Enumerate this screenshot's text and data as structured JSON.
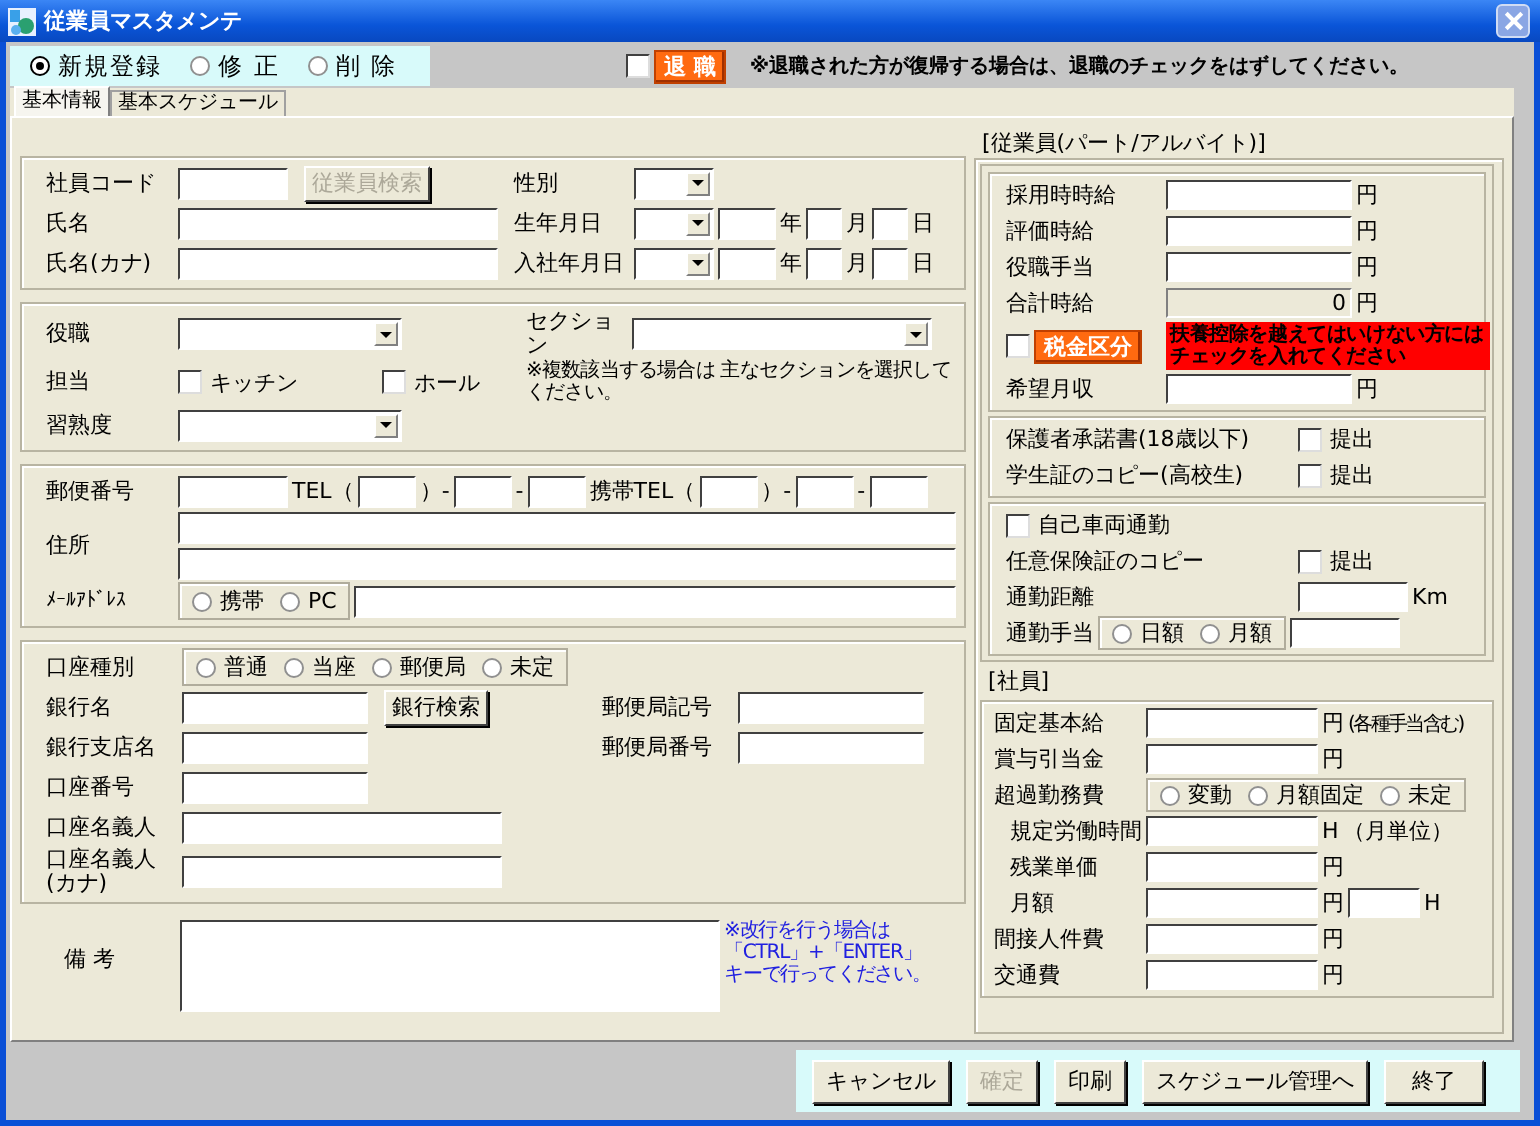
{
  "window": {
    "title": "従業員マスタメンテ"
  },
  "mode_options": [
    {
      "label": "新規登録",
      "selected": true
    },
    {
      "label": "修 正",
      "selected": false
    },
    {
      "label": "削 除",
      "selected": false
    }
  ],
  "retired": {
    "checked": false,
    "label": "退 職",
    "note": "※退職された方が復帰する場合は、退職のチェックをはずしてください。"
  },
  "tabs": [
    {
      "label": "基本情報",
      "selected": true
    },
    {
      "label": "基本スケジュール",
      "selected": false
    }
  ],
  "left_sections": [
    {
      "rows": [
        [
          [
            {
              "kind": "label",
              "text": "社員コード"
            }
          ],
          [
            {
              "kind": "short_field"
            },
            {
              "kind": "button",
              "label": "従業員検索",
              "disabled": true
            }
          ],
          [
            {
              "kind": "label",
              "text": "性別"
            }
          ],
          [
            {
              "kind": "small_select"
            }
          ]
        ],
        [
          [
            {
              "kind": "label",
              "text": "氏名"
            }
          ],
          [
            {
              "kind": "long_field"
            }
          ],
          [
            {
              "kind": "label",
              "text": "生年月日"
            }
          ],
          [
            {
              "kind": "small_select"
            },
            {
              "kind": "small_field"
            },
            {
              "kind": "unit",
              "text": "年"
            },
            {
              "kind": "tiny_field"
            },
            {
              "kind": "unit",
              "text": "月"
            },
            {
              "kind": "tiny_field"
            },
            {
              "kind": "unit",
              "text": "日"
            }
          ]
        ],
        [
          [
            {
              "kind": "label",
              "text": "氏名(カナ)"
            }
          ],
          [
            {
              "kind": "long_field"
            }
          ],
          [
            {
              "kind": "label",
              "text": "入社年月日"
            }
          ],
          [
            {
              "kind": "small_select"
            },
            {
              "kind": "small_field"
            },
            {
              "kind": "unit",
              "text": "年"
            },
            {
              "kind": "tiny_field"
            },
            {
              "kind": "unit",
              "text": "月"
            },
            {
              "kind": "tiny_field"
            },
            {
              "kind": "unit",
              "text": "日"
            }
          ]
        ]
      ]
    },
    {
      "rows": [
        [
          [
            {
              "kind": "label",
              "text": "役職"
            }
          ],
          [
            {
              "kind": "select"
            }
          ],
          [
            {
              "kind": "label",
              "text": "セクション"
            }
          ],
          [
            {
              "kind": "wide_select"
            }
          ]
        ],
        [
          [
            {
              "kind": "label",
              "text": "担当"
            }
          ],
          [
            {
              "kind": "check",
              "label": "キッチン",
              "checked": false
            },
            {
              "kind": "check",
              "label": "ホール",
              "checked": false
            }
          ],
          [
            {
              "kind": "note",
              "text": "※複数該当する場合は 主なセクションを選択してください。"
            }
          ]
        ],
        [
          [
            {
              "kind": "label",
              "text": "習熟度"
            }
          ],
          [
            {
              "kind": "select"
            }
          ]
        ]
      ]
    },
    {
      "rows": [
        [
          [
            {
              "kind": "label",
              "text": "郵便番号"
            }
          ],
          [
            {
              "kind": "short_field"
            },
            {
              "kind": "unit",
              "text": "TEL（"
            },
            {
              "kind": "small_field"
            },
            {
              "kind": "unit",
              "text": "）-"
            },
            {
              "kind": "small_field"
            },
            {
              "kind": "unit",
              "text": "-"
            },
            {
              "kind": "small_field"
            },
            {
              "kind": "unit",
              "text": "携帯TEL（"
            },
            {
              "kind": "small_field"
            },
            {
              "kind": "unit",
              "text": "）-"
            },
            {
              "kind": "small_field"
            },
            {
              "kind": "unit",
              "text": "-"
            },
            {
              "kind": "small_field"
            }
          ]
        ],
        [
          [
            {
              "kind": "label",
              "text": "住所"
            }
          ],
          [
            {
              "kind": "line_field"
            },
            {
              "kind": "line_field"
            }
          ]
        ],
        [
          [
            {
              "kind": "small_label",
              "text": "ﾒｰﾙｱﾄﾞﾚｽ"
            }
          ],
          [
            {
              "kind": "radio_group",
              "options": [
                {
                  "label": "携帯",
                  "selected": false
                },
                {
                  "label": "PC",
                  "selected": false
                }
              ]
            },
            {
              "kind": "wide_field"
            }
          ]
        ]
      ]
    },
    {
      "rows": [
        [
          [
            {
              "kind": "label",
              "text": "口座種別"
            }
          ],
          [
            {
              "kind": "radio_group",
              "options": [
                {
                  "label": "普通",
                  "selected": false
                },
                {
                  "label": "当座",
                  "selected": false
                },
                {
                  "label": "郵便局",
                  "selected": false
                },
                {
                  "label": "未定",
                  "selected": false
                }
              ]
            }
          ]
        ],
        [
          [
            {
              "kind": "label",
              "text": "銀行名"
            }
          ],
          [
            {
              "kind": "medium_field"
            },
            {
              "kind": "button",
              "label": "銀行検索",
              "disabled": false
            }
          ],
          [
            {
              "kind": "label",
              "text": "郵便局記号"
            }
          ],
          [
            {
              "kind": "medium_field"
            }
          ]
        ],
        [
          [
            {
              "kind": "label",
              "text": "銀行支店名"
            }
          ],
          [
            {
              "kind": "medium_field"
            }
          ],
          [
            {
              "kind": "label",
              "text": "郵便局番号"
            }
          ],
          [
            {
              "kind": "medium_field"
            }
          ]
        ],
        [
          [
            {
              "kind": "label",
              "text": "口座番号"
            }
          ],
          [
            {
              "kind": "medium_field"
            }
          ]
        ],
        [
          [
            {
              "kind": "label",
              "text": "口座名義人"
            }
          ],
          [
            {
              "kind": "long_field"
            }
          ]
        ],
        [
          [
            {
              "kind": "label",
              "text": "口座名義人(カナ)"
            }
          ],
          [
            {
              "kind": "long_field"
            }
          ]
        ]
      ]
    }
  ],
  "remarks": {
    "rows": [
      [
        [
          {
            "kind": "label",
            "text": "備 考"
          }
        ],
        [
          {
            "kind": "memo_field"
          },
          {
            "kind": "help",
            "text": "※改行を行う場合は「CTRL」+「ENTER」キーで行ってください。"
          }
        ]
      ]
    ]
  },
  "part_time": {
    "heading": "[従業員(パート/アルバイト)]",
    "groups": [
      {
        "rows": [
          [
            [
              {
                "kind": "label",
                "text": "採用時時給"
              }
            ],
            [
              {
                "kind": "medium_field"
              },
              {
                "kind": "unit",
                "text": "円"
              }
            ]
          ],
          [
            [
              {
                "kind": "label",
                "text": "評価時給"
              }
            ],
            [
              {
                "kind": "medium_field"
              },
              {
                "kind": "unit",
                "text": "円"
              }
            ]
          ],
          [
            [
              {
                "kind": "label",
                "text": "役職手当"
              }
            ],
            [
              {
                "kind": "medium_field"
              },
              {
                "kind": "unit",
                "text": "円"
              }
            ]
          ],
          [
            [
              {
                "kind": "label",
                "text": "合計時給"
              }
            ],
            [
              {
                "kind": "readonly_field",
                "value": "0"
              },
              {
                "kind": "unit",
                "text": "円"
              }
            ]
          ],
          [
            [
              {
                "kind": "check",
                "checked": false
              },
              {
                "kind": "flag_button",
                "label": "税金区分"
              }
            ],
            [
              {
                "kind": "alert",
                "text": "扶養控除を越えてはいけない方にはチェックを入れてください"
              }
            ]
          ],
          [
            [
              {
                "kind": "label",
                "text": "希望月収"
              }
            ],
            [
              {
                "kind": "medium_field"
              },
              {
                "kind": "unit",
                "text": "円"
              }
            ]
          ]
        ]
      },
      {
        "rows": [
          [
            [
              {
                "kind": "label",
                "text": "保護者承諾書(18歳以下)"
              }
            ],
            [
              {
                "kind": "check",
                "label": "提出",
                "checked": false
              }
            ]
          ],
          [
            [
              {
                "kind": "label",
                "text": "学生証のコピー(高校生)"
              }
            ],
            [
              {
                "kind": "check",
                "label": "提出",
                "checked": false
              }
            ]
          ]
        ]
      },
      {
        "rows": [
          [
            [
              {
                "kind": "check",
                "label": "自己車両通勤",
                "checked": false
              }
            ]
          ],
          [
            [
              {
                "kind": "label",
                "text": "任意保険証のコピー"
              }
            ],
            [
              {
                "kind": "check",
                "label": "提出",
                "checked": false
              }
            ]
          ],
          [
            [
              {
                "kind": "label",
                "text": "通勤距離"
              }
            ],
            [
              {
                "kind": "short_field"
              },
              {
                "kind": "unit",
                "text": "Km"
              }
            ]
          ],
          [
            [
              {
                "kind": "label",
                "text": "通勤手当"
              },
              {
                "kind": "radio_group",
                "options": [
                  {
                    "label": "日額",
                    "selected": false
                  },
                  {
                    "label": "月額",
                    "selected": false
                  }
                ]
              },
              {
                "kind": "short_field"
              }
            ]
          ]
        ]
      }
    ]
  },
  "staff": {
    "heading": "[社員]",
    "rows": [
      [
        [
          {
            "kind": "label",
            "text": "固定基本給"
          }
        ],
        [
          {
            "kind": "medium_field"
          },
          {
            "kind": "unit",
            "text": "円"
          },
          {
            "kind": "aside",
            "text": "(各種手当含む)"
          }
        ]
      ],
      [
        [
          {
            "kind": "label",
            "text": "賞与引当金"
          }
        ],
        [
          {
            "kind": "medium_field"
          },
          {
            "kind": "unit",
            "text": "円"
          }
        ]
      ],
      [
        [
          {
            "kind": "label",
            "text": "超過勤務費"
          }
        ],
        [
          {
            "kind": "radio_group",
            "options": [
              {
                "label": "変動",
                "selected": false
              },
              {
                "label": "月額固定",
                "selected": false
              },
              {
                "label": "未定",
                "selected": false
              }
            ]
          }
        ]
      ],
      [
        [
          {
            "kind": "sub_label",
            "text": "規定労働時間"
          }
        ],
        [
          {
            "kind": "medium_field"
          },
          {
            "kind": "unit",
            "text": "H"
          },
          {
            "kind": "unit",
            "text": "（月単位）"
          }
        ]
      ],
      [
        [
          {
            "kind": "sub_label",
            "text": "残業単価"
          }
        ],
        [
          {
            "kind": "medium_field"
          },
          {
            "kind": "unit",
            "text": "円"
          }
        ]
      ],
      [
        [
          {
            "kind": "sub_label",
            "text": "月額"
          }
        ],
        [
          {
            "kind": "medium_field"
          },
          {
            "kind": "unit",
            "text": "円"
          },
          {
            "kind": "small_field"
          },
          {
            "kind": "unit",
            "text": "H"
          }
        ]
      ],
      [
        [
          {
            "kind": "label",
            "text": "間接人件費"
          }
        ],
        [
          {
            "kind": "medium_field"
          },
          {
            "kind": "unit",
            "text": "円"
          }
        ]
      ],
      [
        [
          {
            "kind": "label",
            "text": "交通費"
          }
        ],
        [
          {
            "kind": "medium_field"
          },
          {
            "kind": "unit",
            "text": "円"
          }
        ]
      ]
    ]
  },
  "buttons": [
    {
      "label": "キャンセル",
      "disabled": false
    },
    {
      "label": "確定",
      "disabled": true
    },
    {
      "label": "印刷",
      "disabled": false
    },
    {
      "label": "スケジュール管理へ",
      "disabled": false
    },
    {
      "label": "終了",
      "disabled": false
    }
  ]
}
